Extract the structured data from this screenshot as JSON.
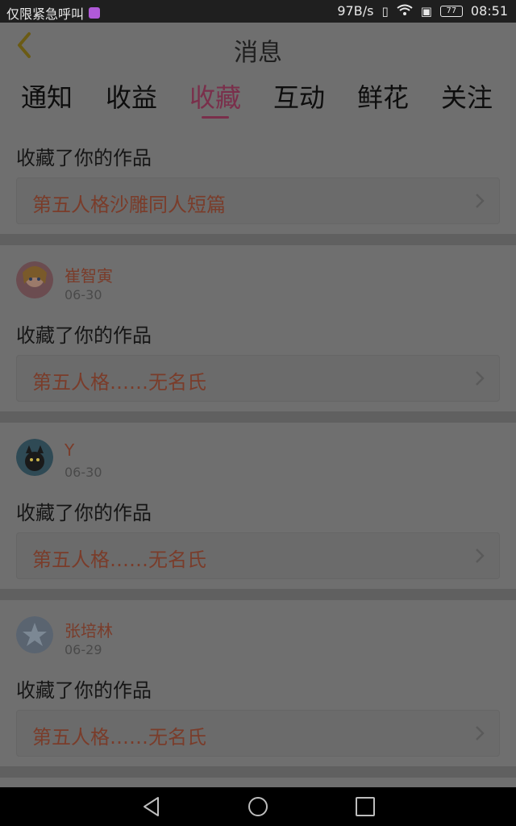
{
  "status_bar": {
    "left_text": "仅限紧急呼叫",
    "speed": "97B/s",
    "battery": "77",
    "time": "08:51"
  },
  "app_bar": {
    "title": "消息"
  },
  "tabs": [
    {
      "label": "通知"
    },
    {
      "label": "收益"
    },
    {
      "label": "收藏",
      "active": true
    },
    {
      "label": "互动"
    },
    {
      "label": "鲜花"
    },
    {
      "label": "关注"
    }
  ],
  "items": [
    {
      "action": "收藏了你的作品",
      "work_title": "第五人格沙雕同人短篇"
    },
    {
      "user": "崔智寅",
      "date": "06-30",
      "action": "收藏了你的作品",
      "work_title": "第五人格……无名氏"
    },
    {
      "user": "Y",
      "date": "06-30",
      "action": "收藏了你的作品",
      "work_title": "第五人格……无名氏"
    },
    {
      "user": "张培林",
      "date": "06-29",
      "action": "收藏了你的作品",
      "work_title": "第五人格……无名氏"
    }
  ],
  "colors": {
    "accent": "#7a2f4b",
    "work_title": "#7a3c2a",
    "overlay_bg": "#6f6f6f"
  }
}
